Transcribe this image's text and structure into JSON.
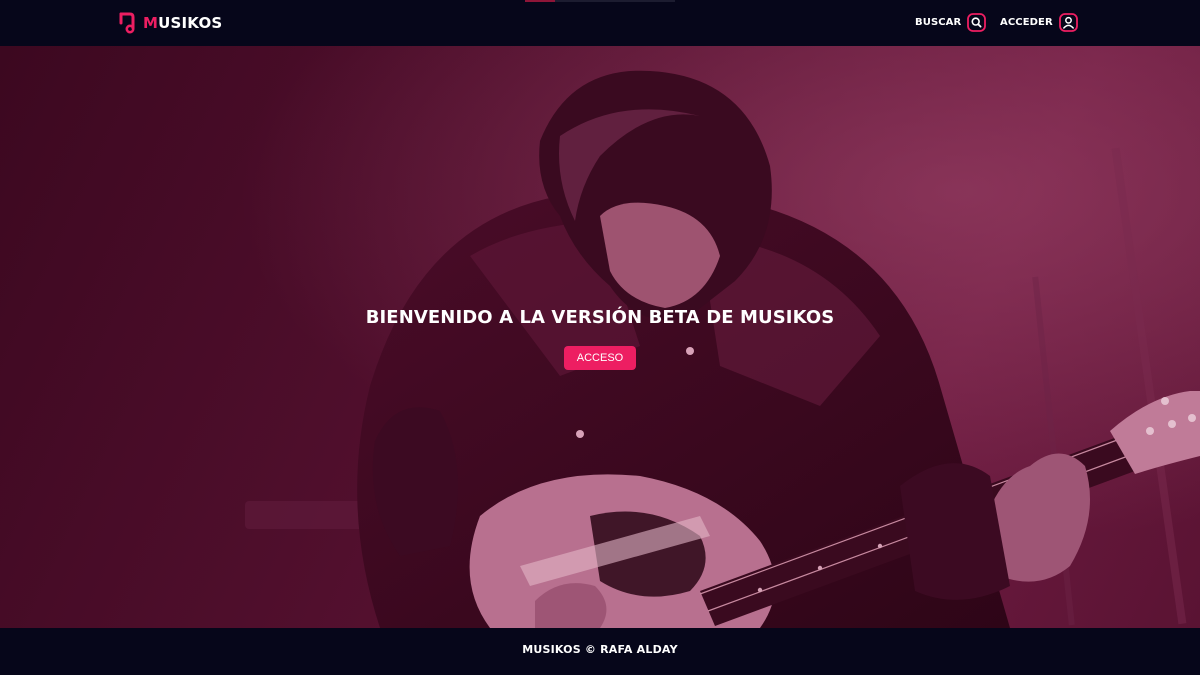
{
  "colors": {
    "accent": "#ed1e62",
    "navbar_background": "#06061a",
    "hero_tint": "#5a1333"
  },
  "header": {
    "brand": {
      "first_letter": "M",
      "rest": "USIKOS",
      "logo_icon": "music-note-logo-icon"
    },
    "nav": {
      "search_label": "BUSCAR",
      "search_icon": "search-icon",
      "login_label": "ACCEDER",
      "login_icon": "user-icon"
    }
  },
  "hero": {
    "background_image": "guitarist-playing-electric-guitar-photo",
    "title": "BIENVENIDO A LA VERSIÓN BETA DE MUSIKOS",
    "button_label": "ACCESO"
  },
  "footer": {
    "text": "MUSIKOS © RAFA ALDAY"
  }
}
